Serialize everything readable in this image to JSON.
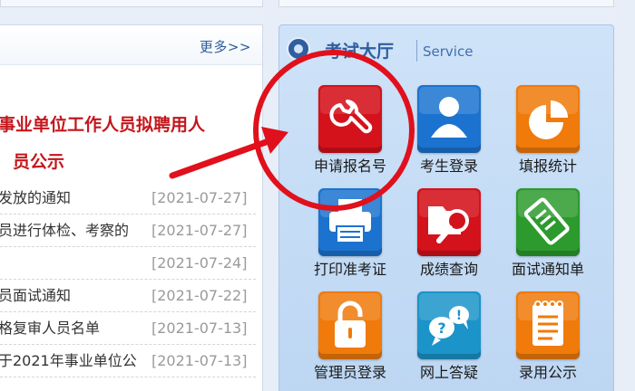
{
  "news": {
    "more_label": "更多>>",
    "headline_line1": "事业单位工作人员拟聘用人",
    "headline_line2": "员公示",
    "items": [
      {
        "title": "发放的通知",
        "date": "[2021-07-27]"
      },
      {
        "title": "员进行体检、考察的",
        "date": "[2021-07-27]"
      },
      {
        "title": "",
        "date": "[2021-07-24]"
      },
      {
        "title": "员面试通知",
        "date": "[2021-07-22]"
      },
      {
        "title": "格复审人员名单",
        "date": "[2021-07-13]"
      },
      {
        "title": "于2021年事业单位公",
        "date": "[2021-07-13]"
      }
    ]
  },
  "service": {
    "title": "考试大厅",
    "subtitle": "Service",
    "tiles": [
      {
        "label": "申请报名号",
        "icon": "wrench-icon",
        "color": "#d4121b"
      },
      {
        "label": "考生登录",
        "icon": "user-icon",
        "color": "#1b73cf"
      },
      {
        "label": "填报统计",
        "icon": "pie-chart-icon",
        "color": "#f07a0a"
      },
      {
        "label": "打印准考证",
        "icon": "printer-icon",
        "color": "#1b73cf"
      },
      {
        "label": "成绩查询",
        "icon": "folder-search-icon",
        "color": "#d4121b"
      },
      {
        "label": "面试通知单",
        "icon": "document-icon",
        "color": "#2d9a2d"
      },
      {
        "label": "管理员登录",
        "icon": "lock-icon",
        "color": "#f07a0a"
      },
      {
        "label": "网上答疑",
        "icon": "question-bubbles-icon",
        "color": "#1a94c9"
      },
      {
        "label": "录用公示",
        "icon": "notepad-icon",
        "color": "#f07a0a"
      }
    ]
  },
  "annotation": {
    "color": "#e0101c"
  }
}
